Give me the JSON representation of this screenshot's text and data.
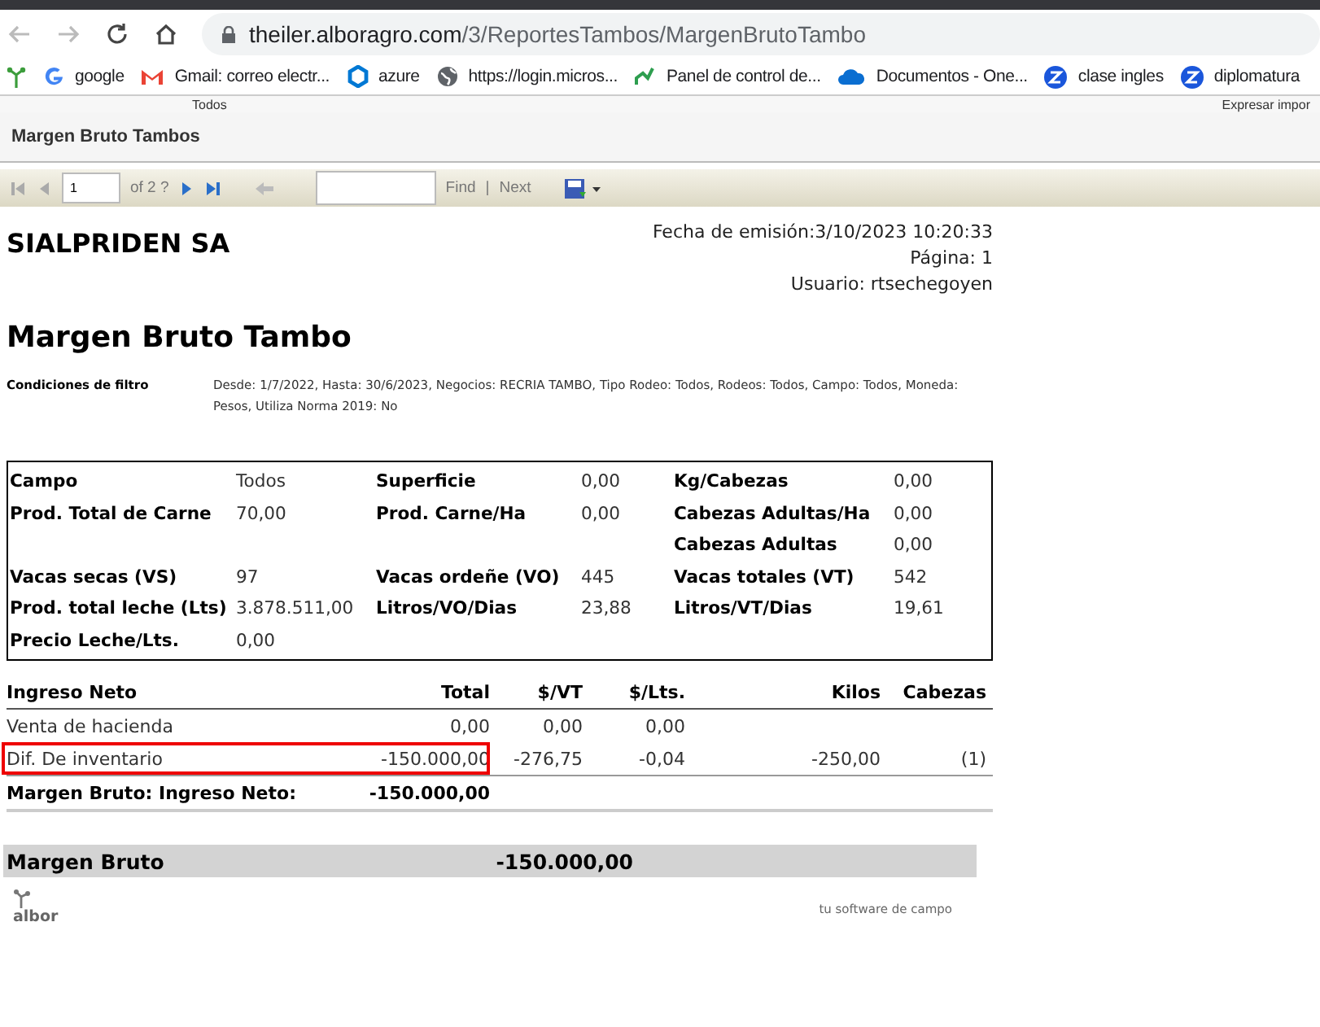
{
  "browser": {
    "url_host": "theiler.alboragro.com",
    "url_path": "/3/ReportesTambos/MargenBrutoTambo",
    "bookmarks": [
      {
        "label": "google",
        "kind": "google"
      },
      {
        "label": "Gmail: correo electr...",
        "kind": "gmail"
      },
      {
        "label": "azure",
        "kind": "azure"
      },
      {
        "label": "https://login.micros...",
        "kind": "globe"
      },
      {
        "label": "Panel de control de...",
        "kind": "panel"
      },
      {
        "label": "Documentos - One...",
        "kind": "cloud"
      },
      {
        "label": "clase ingles",
        "kind": "z"
      },
      {
        "label": "diplomatura",
        "kind": "z"
      }
    ]
  },
  "behind_strip": {
    "left": "Todos",
    "right": "Expresar impor"
  },
  "page_title": "Margen Bruto Tambos",
  "toolbar": {
    "page": "1",
    "page_of": "of 2 ?",
    "find_label": "Find",
    "separator": "|",
    "next_label": "Next"
  },
  "report": {
    "company": "SIALPRIDEN SA",
    "issued": "Fecha de emisión:3/10/2023 10:20:33",
    "page": "Página: 1",
    "user": "Usuario: rtsechegoyen",
    "title": "Margen Bruto Tambo",
    "filter_label": "Condiciones de filtro",
    "filter_text": "Desde: 1/7/2022, Hasta: 30/6/2023, Negocios: RECRIA TAMBO, Tipo Rodeo: Todos, Rodeos: Todos, Campo: Todos, Moneda: Pesos, Utiliza Norma 2019: No",
    "summary_rows": [
      [
        {
          "label": "Campo",
          "value": "Todos"
        },
        {
          "label": "Superficie",
          "value": "0,00"
        },
        {
          "label": "Kg/Cabezas",
          "value": "0,00"
        }
      ],
      [
        {
          "label": "Prod. Total de Carne",
          "value": "70,00"
        },
        {
          "label": "Prod. Carne/Ha",
          "value": "0,00"
        },
        {
          "label": "Cabezas Adultas/Ha",
          "value": "0,00"
        }
      ],
      [
        null,
        null,
        {
          "label": "Cabezas Adultas",
          "value": "0,00"
        }
      ],
      [
        {
          "label": "Vacas secas (VS)",
          "value": "97"
        },
        {
          "label": "Vacas ordeñe (VO)",
          "value": "445"
        },
        {
          "label": "Vacas totales (VT)",
          "value": "542"
        }
      ],
      [
        {
          "label": "Prod. total leche (Lts)",
          "value": "3.878.511,00"
        },
        {
          "label": "Litros/VO/Dias",
          "value": "23,88"
        },
        {
          "label": "Litros/VT/Dias",
          "value": "19,61"
        }
      ],
      [
        {
          "label": "Precio Leche/Lts.",
          "value": "0,00"
        },
        null,
        null
      ]
    ],
    "income": {
      "columns": [
        "Ingreso Neto",
        "Total",
        "$/VT",
        "$/Lts.",
        "Kilos",
        "Cabezas"
      ],
      "rows": [
        {
          "cells": [
            "Venta de hacienda",
            "0,00",
            "0,00",
            "0,00",
            "",
            ""
          ],
          "highlighted": false
        },
        {
          "cells": [
            "Dif. De inventario",
            "-150.000,00",
            "-276,75",
            "-0,04",
            "-250,00",
            "(1)"
          ],
          "highlighted": true
        }
      ],
      "total_label": "Margen Bruto: Ingreso Neto:",
      "total_value": "-150.000,00"
    },
    "gross_label": "Margen Bruto",
    "gross_value": "-150.000,00",
    "logo_text": "albor",
    "slogan": "tu software de campo"
  }
}
